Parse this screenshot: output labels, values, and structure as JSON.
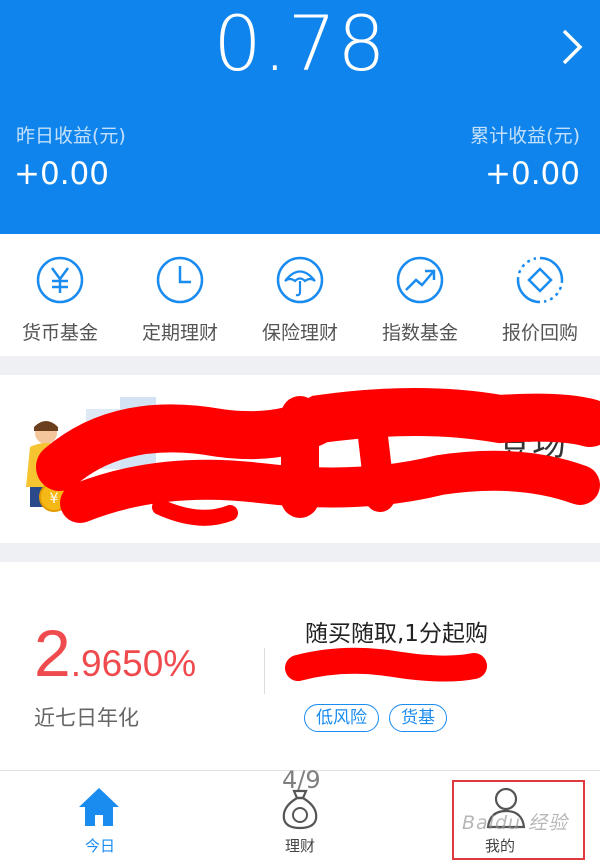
{
  "header": {
    "total_amount": "0.78",
    "yesterday_label": "昨日收益(元)",
    "yesterday_value": "+0.00",
    "cumulative_label": "累计收益(元)",
    "cumulative_value": "+0.00"
  },
  "categories": [
    {
      "label": "货币基金",
      "icon": "yuan-coin-icon"
    },
    {
      "label": "定期理财",
      "icon": "clock-icon"
    },
    {
      "label": "保险理财",
      "icon": "umbrella-icon"
    },
    {
      "label": "指数基金",
      "icon": "trend-up-icon"
    },
    {
      "label": "报价回购",
      "icon": "diamond-cycle-icon"
    }
  ],
  "banner": {
    "visible_text": "登场"
  },
  "product": {
    "rate_integer": "2",
    "rate_decimal": ".9650%",
    "rate_label": "近七日年化",
    "tagline": "随买随取,1分起购",
    "tags": [
      "低风险",
      "货基"
    ]
  },
  "nav": {
    "items": [
      {
        "label": "今日",
        "icon": "home-icon"
      },
      {
        "label": "理财",
        "icon": "money-bag-icon"
      },
      {
        "label": "我的",
        "icon": "user-icon"
      }
    ],
    "page_counter": "4/9"
  },
  "watermark": "Baidu 经验",
  "colors": {
    "brand_blue": "#0f84ec",
    "accent_red": "#ef4b4e",
    "redaction_red": "#ff0000"
  }
}
